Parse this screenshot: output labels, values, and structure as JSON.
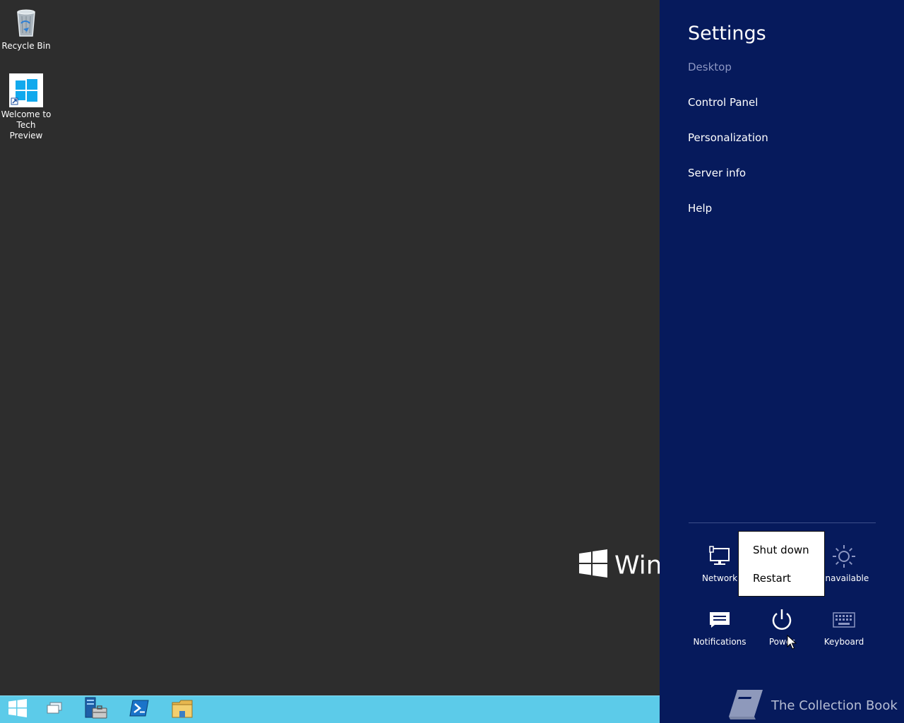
{
  "desktop": {
    "icons": [
      {
        "label": "Recycle Bin",
        "icon": "recycle-bin-icon"
      },
      {
        "label": "Welcome to Tech Preview",
        "icon": "windows-logo-icon"
      }
    ],
    "watermark_text": "Windows"
  },
  "taskbar": {
    "items": [
      {
        "icon": "start-icon"
      },
      {
        "icon": "task-view-icon"
      },
      {
        "icon": "server-manager-icon"
      },
      {
        "icon": "powershell-icon"
      },
      {
        "icon": "file-explorer-icon"
      }
    ]
  },
  "charm": {
    "title": "Settings",
    "subtitle": "Desktop",
    "links": [
      "Control Panel",
      "Personalization",
      "Server info",
      "Help"
    ],
    "tiles": [
      {
        "label": "Network",
        "icon": "network-icon"
      },
      {
        "label": "Unavailable",
        "icon": "brightness-icon"
      },
      {
        "label": "Notifications",
        "icon": "notifications-icon"
      },
      {
        "label": "Power",
        "icon": "power-icon"
      },
      {
        "label": "Keyboard",
        "icon": "keyboard-icon"
      }
    ],
    "power_menu": [
      "Shut down",
      "Restart"
    ]
  },
  "brand": {
    "text": "The Collection Book",
    "icon": "book-icon"
  },
  "colors": {
    "charm_bg": "#061a5c",
    "taskbar_bg": "#5ccbe9",
    "desktop_bg": "#2d2d2d"
  }
}
